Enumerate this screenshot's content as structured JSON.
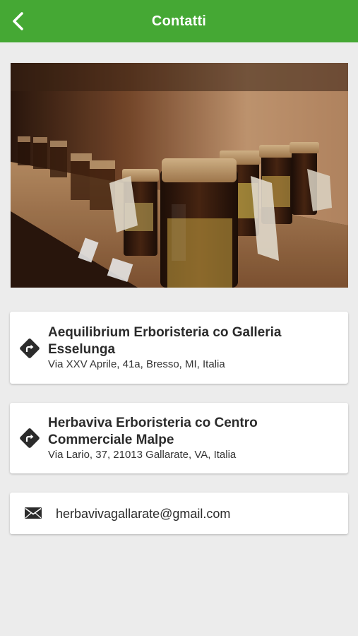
{
  "header": {
    "title": "Contatti",
    "back_icon": "chevron-left-icon",
    "color": "#45a834"
  },
  "hero": {
    "image": "shelf-of-herbal-jars-photo"
  },
  "contacts": [
    {
      "name": "Aequilibrium Erboristeria co Galleria Esselunga",
      "address": "Via XXV Aprile, 41a, Bresso, MI, Italia",
      "icon": "directions-icon"
    },
    {
      "name": "Herbaviva Erboristeria co Centro Commerciale Malpe",
      "address": "Via Lario, 37, 21013 Gallarate, VA, Italia",
      "icon": "directions-icon"
    }
  ],
  "email": {
    "address": "herbavivagallarate@gmail.com",
    "icon": "envelope-icon"
  }
}
